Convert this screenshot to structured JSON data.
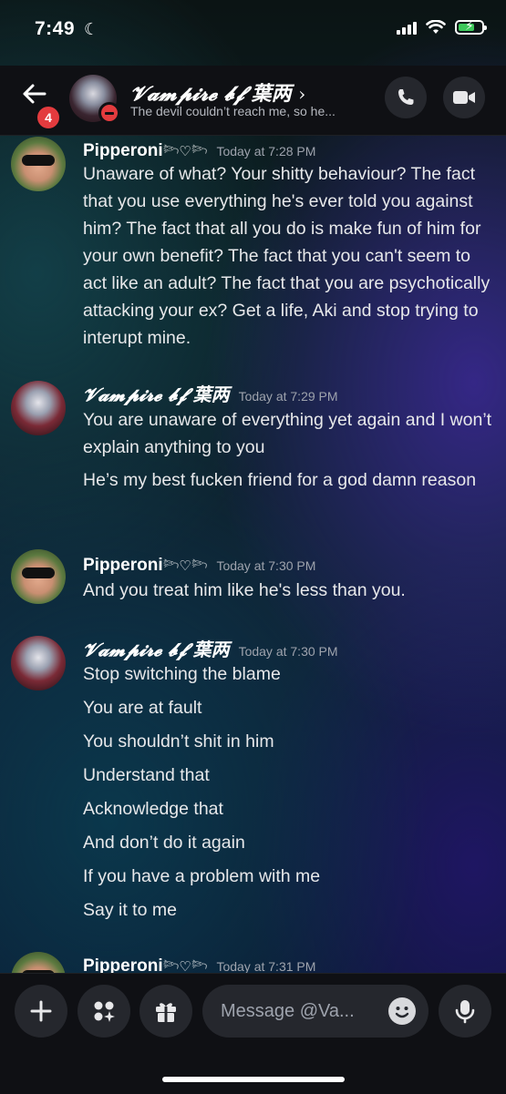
{
  "status": {
    "time": "7:49"
  },
  "header": {
    "badge": "4",
    "channel_name": "𝓥𝓪𝓶𝓹𝓲𝓻𝓮 𝓫𝓯 葉两",
    "chevron": "›",
    "status_text": "The devil couldn’t reach me, so he..."
  },
  "messages": [
    {
      "author": "Pipperoni",
      "decor": "𓆸♡𓆸",
      "timestamp": "Today at 7:28 PM",
      "lines": [
        "Unaware of what? Your shitty behaviour? The fact that you use everything he's ever told you against him? The fact that all you do is make fun of him for your own benefit? The fact that you can't seem to act like an adult? The fact that you are psychotically attacking your ex? Get a life, Aki and stop trying to interupt mine."
      ]
    },
    {
      "author": "𝓥𝓪𝓶𝓹𝓲𝓻𝓮 𝓫𝓯 葉两",
      "timestamp": "Today at 7:29 PM",
      "lines": [
        "You are unaware of everything yet again and I won’t explain anything to you",
        "He’s my best fucken friend for a god damn reason"
      ]
    },
    {
      "author": "Pipperoni",
      "decor": "𓆸♡𓆸",
      "timestamp": "Today at 7:30 PM",
      "lines": [
        "And you treat him like he's less than you."
      ]
    },
    {
      "author": "𝓥𝓪𝓶𝓹𝓲𝓻𝓮 𝓫𝓯 葉两",
      "timestamp": "Today at 7:30 PM",
      "lines": [
        "Stop switching the blame",
        "You are at fault",
        "You shouldn’t shit in him",
        "Understand that",
        "Acknowledge that",
        "And don’t do it again",
        "If you have a problem with me",
        "Say it to me"
      ]
    },
    {
      "author": "Pipperoni",
      "decor": "𓆸♡𓆸",
      "timestamp": "Today at 7:31 PM",
      "lines": []
    }
  ],
  "composer": {
    "placeholder": "Message @Va..."
  },
  "colors": {
    "accent_red": "#e33b3e",
    "battery_green": "#3ec95b",
    "panel": "#0f1014"
  }
}
